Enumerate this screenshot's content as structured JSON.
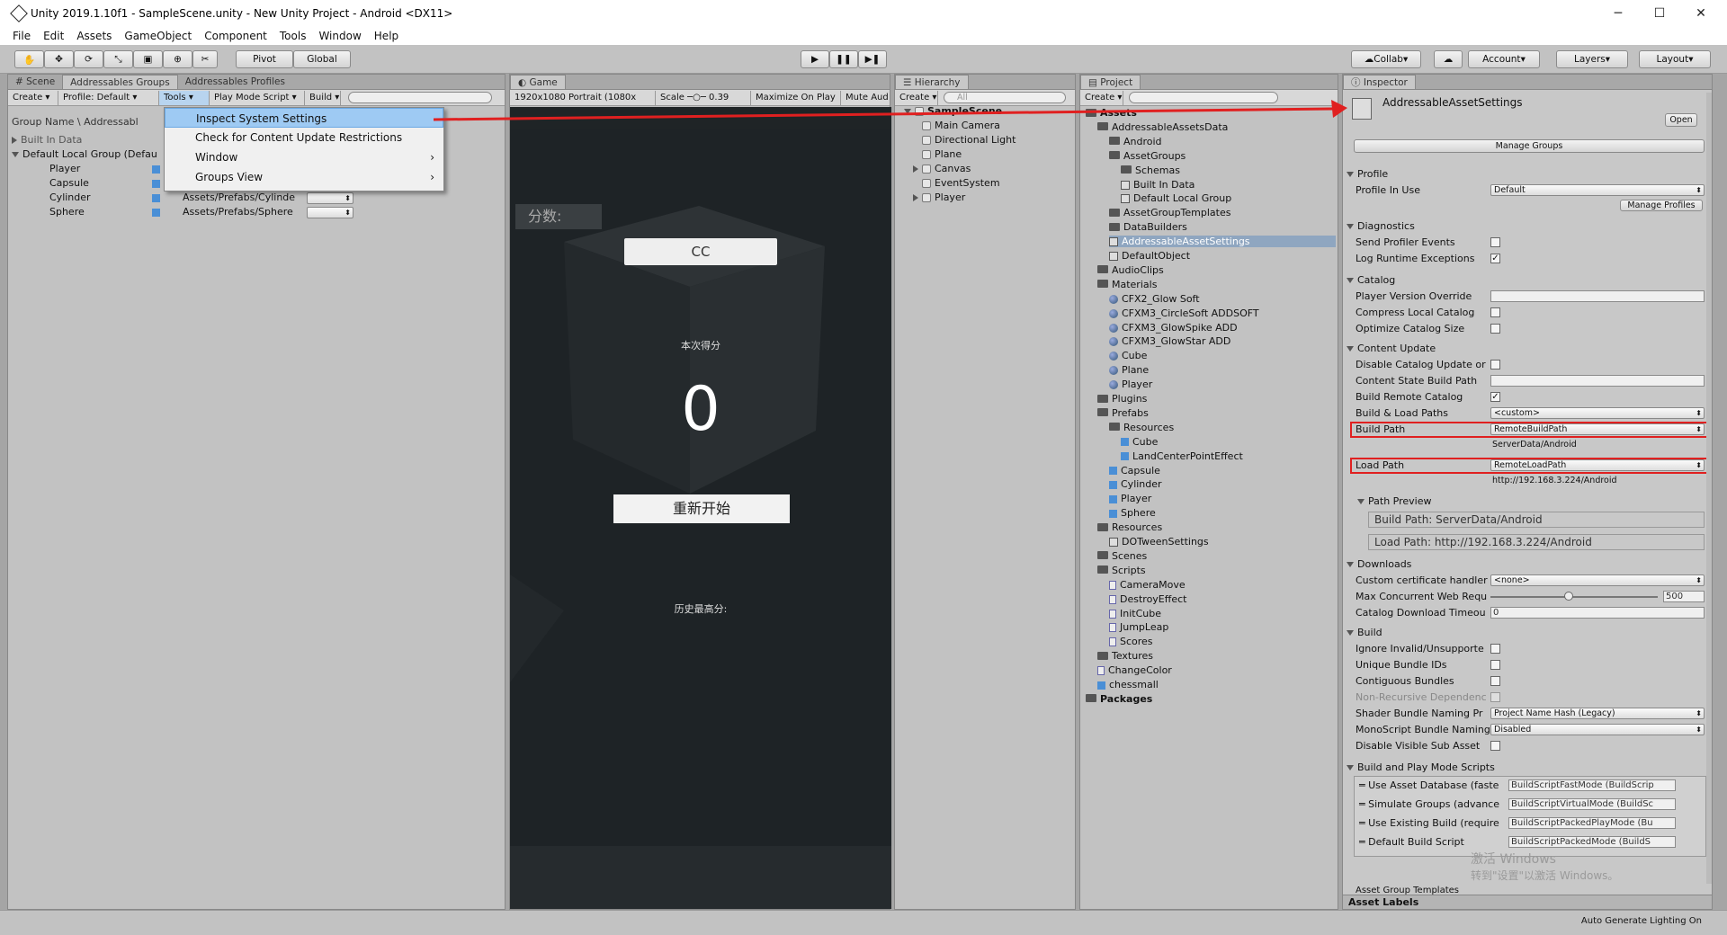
{
  "window": {
    "title": "Unity 2019.1.10f1 - SampleScene.unity - New Unity Project - Android <DX11>",
    "minimize": "─",
    "maximize": "☐",
    "close": "✕"
  },
  "menubar": [
    "File",
    "Edit",
    "Assets",
    "GameObject",
    "Component",
    "Tools",
    "Window",
    "Help"
  ],
  "toolbar": {
    "pivot": "Pivot",
    "global": "Global",
    "collab": "Collab",
    "account": "Account",
    "layers": "Layers",
    "layout": "Layout"
  },
  "addr": {
    "tabs": [
      "Scene",
      "Addressables Groups",
      "Addressables Profiles"
    ],
    "create": "Create",
    "profile": "Profile: Default",
    "tools": "Tools",
    "play_mode": "Play Mode Script",
    "build": "Build",
    "header": "Group Name \\ Addressabl",
    "built_in": "Built In Data",
    "default_group": "Default Local Group (Defau",
    "items": [
      {
        "name": "Player",
        "path": ""
      },
      {
        "name": "Capsule",
        "path": ""
      },
      {
        "name": "Cylinder",
        "path": "Assets/Prefabs/Cylinde"
      },
      {
        "name": "Sphere",
        "path": "Assets/Prefabs/Sphere"
      }
    ]
  },
  "tools_menu": {
    "items": [
      "Inspect System Settings",
      "Check for Content Update Restrictions",
      "Window",
      "Groups View"
    ]
  },
  "game": {
    "tab": "Game",
    "resolution": "1920x1080 Portrait (1080x",
    "scale_label": "Scale",
    "scale_value": "0.39",
    "maximize": "Maximize On Play",
    "mute": "Mute Aud",
    "score_label": "分数:",
    "cc_button": "CC",
    "round_label": "本次得分",
    "round_score": "0",
    "restart": "重新开始",
    "history": "历史最高分:"
  },
  "hierarchy": {
    "tab": "Hierarchy",
    "create": "Create",
    "search": "All",
    "scene": "SampleScene",
    "items": [
      "Main Camera",
      "Directional Light",
      "Plane",
      "Canvas",
      "EventSystem",
      "Player"
    ]
  },
  "project": {
    "tab": "Project",
    "create": "Create",
    "rows": [
      {
        "t": "Assets",
        "d": 0,
        "k": "folder",
        "b": true
      },
      {
        "t": "AddressableAssetsData",
        "d": 1,
        "k": "folder"
      },
      {
        "t": "Android",
        "d": 2,
        "k": "folder"
      },
      {
        "t": "AssetGroups",
        "d": 2,
        "k": "folder"
      },
      {
        "t": "Schemas",
        "d": 3,
        "k": "folder"
      },
      {
        "t": "Built In Data",
        "d": 3,
        "k": "so"
      },
      {
        "t": "Default Local Group",
        "d": 3,
        "k": "so"
      },
      {
        "t": "AssetGroupTemplates",
        "d": 2,
        "k": "folder"
      },
      {
        "t": "DataBuilders",
        "d": 2,
        "k": "folder"
      },
      {
        "t": "AddressableAssetSettings",
        "d": 2,
        "k": "so",
        "sel": true
      },
      {
        "t": "DefaultObject",
        "d": 2,
        "k": "so"
      },
      {
        "t": "AudioClips",
        "d": 1,
        "k": "folder"
      },
      {
        "t": "Materials",
        "d": 1,
        "k": "folder"
      },
      {
        "t": "CFX2_Glow Soft",
        "d": 2,
        "k": "sph"
      },
      {
        "t": "CFXM3_CircleSoft ADDSOFT",
        "d": 2,
        "k": "sph"
      },
      {
        "t": "CFXM3_GlowSpike ADD",
        "d": 2,
        "k": "sph"
      },
      {
        "t": "CFXM3_GlowStar ADD",
        "d": 2,
        "k": "sph"
      },
      {
        "t": "Cube",
        "d": 2,
        "k": "sph"
      },
      {
        "t": "Plane",
        "d": 2,
        "k": "sph"
      },
      {
        "t": "Player",
        "d": 2,
        "k": "sph"
      },
      {
        "t": "Plugins",
        "d": 1,
        "k": "folder"
      },
      {
        "t": "Prefabs",
        "d": 1,
        "k": "folder"
      },
      {
        "t": "Resources",
        "d": 2,
        "k": "folder"
      },
      {
        "t": "Cube",
        "d": 3,
        "k": "cube"
      },
      {
        "t": "LandCenterPointEffect",
        "d": 3,
        "k": "cube"
      },
      {
        "t": "Capsule",
        "d": 2,
        "k": "cube"
      },
      {
        "t": "Cylinder",
        "d": 2,
        "k": "cube"
      },
      {
        "t": "Player",
        "d": 2,
        "k": "cube"
      },
      {
        "t": "Sphere",
        "d": 2,
        "k": "cube"
      },
      {
        "t": "Resources",
        "d": 1,
        "k": "folder"
      },
      {
        "t": "DOTweenSettings",
        "d": 2,
        "k": "so"
      },
      {
        "t": "Scenes",
        "d": 1,
        "k": "folder"
      },
      {
        "t": "Scripts",
        "d": 1,
        "k": "folder"
      },
      {
        "t": "CameraMove",
        "d": 2,
        "k": "script"
      },
      {
        "t": "DestroyEffect",
        "d": 2,
        "k": "script"
      },
      {
        "t": "InitCube",
        "d": 2,
        "k": "script"
      },
      {
        "t": "JumpLeap",
        "d": 2,
        "k": "script"
      },
      {
        "t": "Scores",
        "d": 2,
        "k": "script"
      },
      {
        "t": "Textures",
        "d": 1,
        "k": "folder"
      },
      {
        "t": "ChangeColor",
        "d": 1,
        "k": "script"
      },
      {
        "t": "chessmall",
        "d": 1,
        "k": "cube"
      },
      {
        "t": "Packages",
        "d": 0,
        "k": "folder",
        "b": true
      }
    ]
  },
  "inspector": {
    "tab": "Inspector",
    "object": "AddressableAssetSettings",
    "open": "Open",
    "manage_groups": "Manage Groups",
    "manage_profiles": "Manage Profiles",
    "profile_section": "Profile",
    "profile_in_use": "Profile In Use",
    "profile_value": "Default",
    "diagnostics": "Diagnostics",
    "send_profiler": "Send Profiler Events",
    "log_runtime": "Log Runtime Exceptions",
    "catalog": "Catalog",
    "player_version": "Player Version Override",
    "compress_catalog": "Compress Local Catalog",
    "optimize_catalog": "Optimize Catalog Size",
    "content_update": "Content Update",
    "disable_catalog": "Disable Catalog Update or",
    "content_state": "Content State Build Path",
    "build_remote": "Build Remote Catalog",
    "build_load": "Build & Load Paths",
    "build_load_value": "<custom>",
    "build_path": "Build Path",
    "build_path_value": "RemoteBuildPath",
    "build_path_preview": "ServerData/Android",
    "load_path": "Load Path",
    "load_path_value": "RemoteLoadPath",
    "load_path_preview": "http://192.168.3.224/Android",
    "path_preview": "Path Preview",
    "pp_build": "Build Path: ServerData/Android",
    "pp_load": "Load Path: http://192.168.3.224/Android",
    "downloads": "Downloads",
    "custom_cert": "Custom certificate handler",
    "custom_cert_value": "<none>",
    "max_web": "Max Concurrent Web Requ",
    "max_web_value": "500",
    "catalog_timeout": "Catalog Download Timeou",
    "catalog_timeout_value": "0",
    "build": "Build",
    "ignore_invalid": "Ignore Invalid/Unsupporte",
    "unique_ids": "Unique Bundle IDs",
    "contiguous": "Contiguous Bundles",
    "non_recursive": "Non-Recursive Dependenc",
    "shader_naming": "Shader Bundle Naming Pr",
    "shader_naming_value": "Project Name Hash (Legacy)",
    "mono_naming": "MonoScript Bundle Naming",
    "mono_naming_value": "Disabled",
    "disable_sub": "Disable Visible Sub Asset",
    "play_scripts": "Build and Play Mode Scripts",
    "scripts": [
      {
        "label": "Use Asset Database (faste",
        "value": "BuildScriptFastMode (BuildScrip"
      },
      {
        "label": "Simulate Groups (advance",
        "value": "BuildScriptVirtualMode (BuildSc"
      },
      {
        "label": "Use Existing Build (require",
        "value": "BuildScriptPackedPlayMode (Bu"
      },
      {
        "label": "Default Build Script",
        "value": "BuildScriptPackedMode (BuildS"
      }
    ],
    "asset_group_templates": "Asset Group Templates",
    "asset_labels": "Asset Labels",
    "watermark1": "激活 Windows",
    "watermark2": "转到\"设置\"以激活 Windows。"
  },
  "status": {
    "right": "Auto Generate Lighting On"
  }
}
